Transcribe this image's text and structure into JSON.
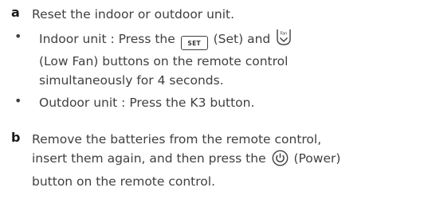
{
  "step_a": {
    "letter": "a",
    "text": "Reset the indoor or outdoor unit."
  },
  "bullet_indoor": {
    "dot": "•",
    "pre": "Indoor unit : Press the ",
    "set_key_label": "SET",
    "mid": " (Set) and ",
    "fan_icon_label": "Fan",
    "line2": "(Low Fan) buttons on the remote control",
    "line3": "simultaneously for 4 seconds."
  },
  "bullet_outdoor": {
    "dot": "•",
    "text": "Outdoor unit : Press the K3 button."
  },
  "step_b": {
    "letter": "b",
    "line1": "Remove the batteries from the remote control,",
    "line2_pre": "insert them again, and then press the ",
    "line2_post": " (Power)",
    "line3": "button on the remote control."
  }
}
